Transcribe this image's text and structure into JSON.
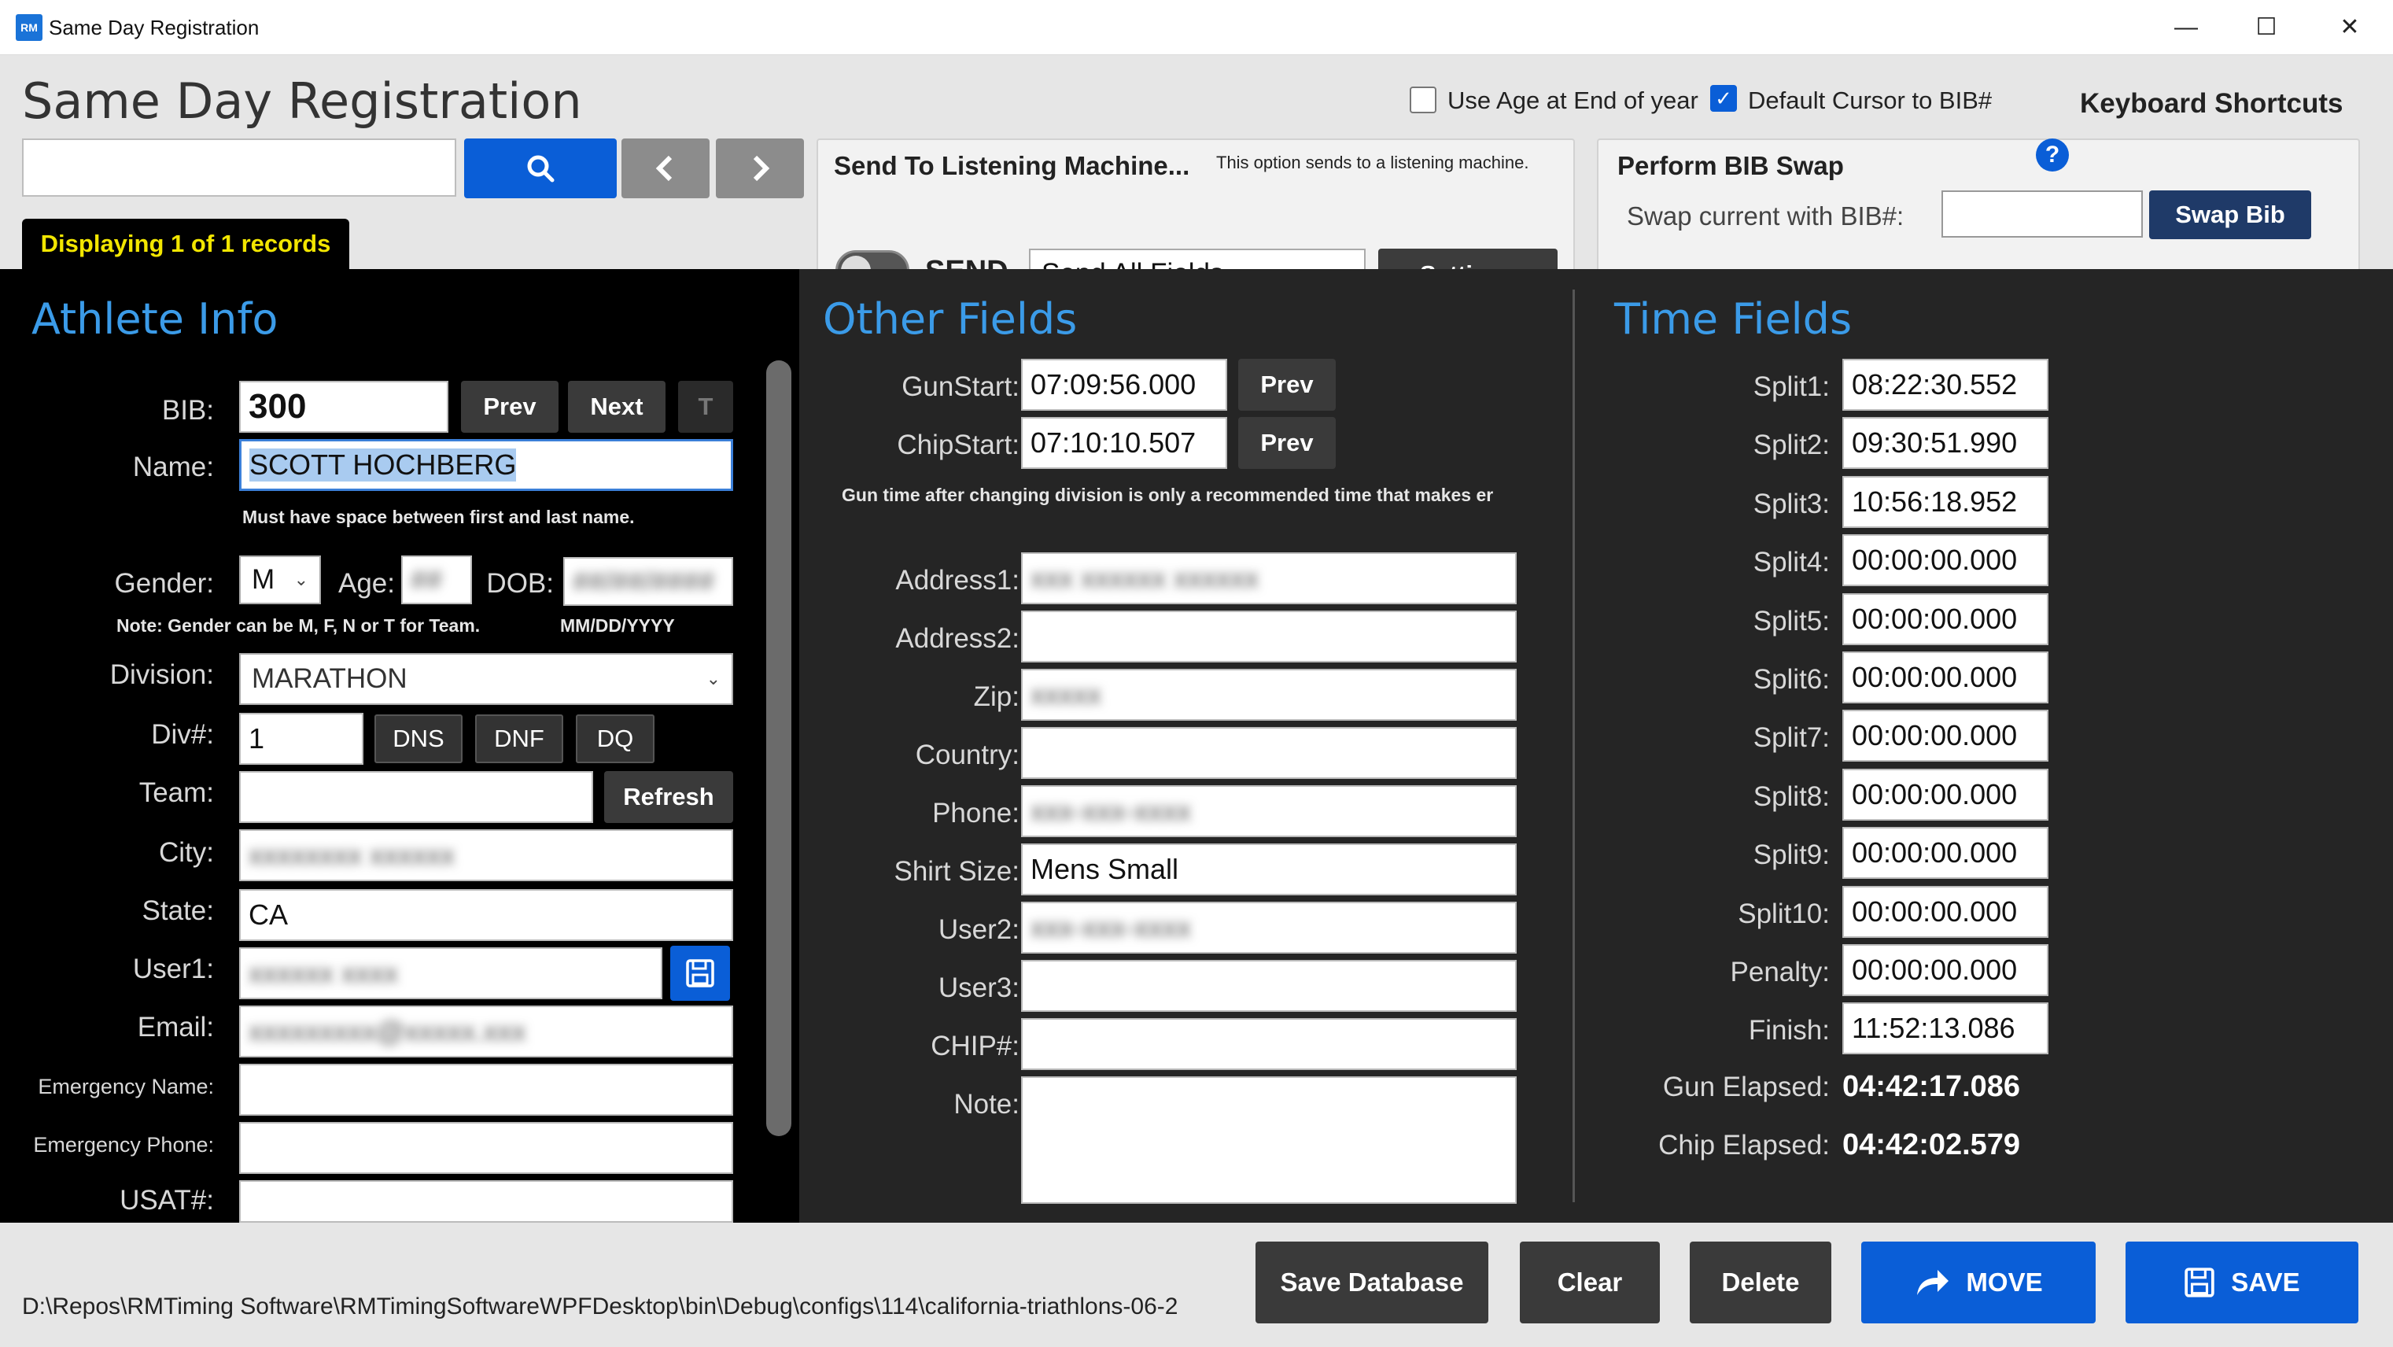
{
  "window": {
    "title": "Same Day Registration",
    "icon_text": "RM",
    "minimize": "—",
    "maximize": "☐",
    "close": "✕"
  },
  "header": {
    "page_title": "Same Day Registration",
    "search": {
      "value": "",
      "placeholder": ""
    },
    "records_tab": "Displaying 1 of 1 records",
    "options": {
      "use_age_label": "Use Age at End of year",
      "use_age_checked": false,
      "default_cursor_label": "Default Cursor to BIB#",
      "default_cursor_checked": true,
      "keyboard_shortcuts": "Keyboard Shortcuts"
    },
    "send_panel": {
      "title": "Send To Listening Machine...",
      "hint": "This option sends to a listening machine.",
      "toggle_label": "SEND",
      "toggle_on": false,
      "mode": "Send All Fields",
      "settings": "Settings"
    },
    "swap_panel": {
      "title": "Perform BIB Swap",
      "label": "Swap current with BIB#:",
      "value": "",
      "button": "Swap Bib"
    }
  },
  "athlete": {
    "section": "Athlete Info",
    "bib_label": "BIB:",
    "bib": "300",
    "prev": "Prev",
    "next": "Next",
    "t": "T",
    "name_label": "Name:",
    "name": "SCOTT HOCHBERG",
    "name_note": "Must have space between first and last name.",
    "gender_label": "Gender:",
    "gender": "M",
    "age_label": "Age:",
    "age": "##",
    "dob_label": "DOB:",
    "dob": "##/##/####",
    "gender_note": "Note: Gender can be M, F, N or T for Team.",
    "dob_format": "MM/DD/YYYY",
    "division_label": "Division:",
    "division": "MARATHON",
    "divnum_label": "Div#:",
    "divnum": "1",
    "dns": "DNS",
    "dnf": "DNF",
    "dq": "DQ",
    "team_label": "Team:",
    "team": "",
    "refresh": "Refresh",
    "city_label": "City:",
    "city": "xxxxxxxx xxxxxx",
    "state_label": "State:",
    "state": "CA",
    "user1_label": "User1:",
    "user1": "xxxxxx xxxx",
    "email_label": "Email:",
    "email": "xxxxxxxxx@xxxxx.xxx",
    "emergency_name_label": "Emergency Name:",
    "emergency_name": "",
    "emergency_phone_label": "Emergency Phone:",
    "emergency_phone": "",
    "usat_label": "USAT#:",
    "usat": ""
  },
  "other": {
    "section": "Other Fields",
    "gunstart_label": "GunStart:",
    "gunstart": "07:09:56.000",
    "chipstart_label": "ChipStart:",
    "chipstart": "07:10:10.507",
    "prev": "Prev",
    "note_text": "Gun time after changing division is only a recommended time that makes er",
    "address1_label": "Address1:",
    "address1": "xxx xxxxxx xxxxxx",
    "address2_label": "Address2:",
    "address2": "",
    "zip_label": "Zip:",
    "zip": "xxxxx",
    "country_label": "Country:",
    "country": "",
    "phone_label": "Phone:",
    "phone": "xxx-xxx-xxxx",
    "shirt_label": "Shirt Size:",
    "shirt": "Mens Small",
    "user2_label": "User2:",
    "user2": "xxx-xxx-xxxx",
    "user3_label": "User3:",
    "user3": "",
    "chip_label": "CHIP#:",
    "chip": "",
    "note_label": "Note:",
    "note": ""
  },
  "time": {
    "section": "Time Fields",
    "splits": [
      {
        "label": "Split1:",
        "value": "08:22:30.552"
      },
      {
        "label": "Split2:",
        "value": "09:30:51.990"
      },
      {
        "label": "Split3:",
        "value": "10:56:18.952"
      },
      {
        "label": "Split4:",
        "value": "00:00:00.000"
      },
      {
        "label": "Split5:",
        "value": "00:00:00.000"
      },
      {
        "label": "Split6:",
        "value": "00:00:00.000"
      },
      {
        "label": "Split7:",
        "value": "00:00:00.000"
      },
      {
        "label": "Split8:",
        "value": "00:00:00.000"
      },
      {
        "label": "Split9:",
        "value": "00:00:00.000"
      },
      {
        "label": "Split10:",
        "value": "00:00:00.000"
      },
      {
        "label": "Penalty:",
        "value": "00:00:00.000"
      },
      {
        "label": "Finish:",
        "value": "11:52:13.086"
      }
    ],
    "gun_elapsed_label": "Gun Elapsed:",
    "gun_elapsed": "04:42:17.086",
    "chip_elapsed_label": "Chip Elapsed:",
    "chip_elapsed": "04:42:02.579"
  },
  "footer": {
    "path": "D:\\Repos\\RMTiming Software\\RMTimingSoftwareWPFDesktop\\bin\\Debug\\configs\\114\\california-triathlons-06-2",
    "save_database": "Save Database",
    "clear": "Clear",
    "delete": "Delete",
    "move": "MOVE",
    "save": "SAVE"
  },
  "colors": {
    "accent": "#0a5ed7",
    "section_title": "#3b9be8",
    "tab_text": "#f2e600"
  }
}
